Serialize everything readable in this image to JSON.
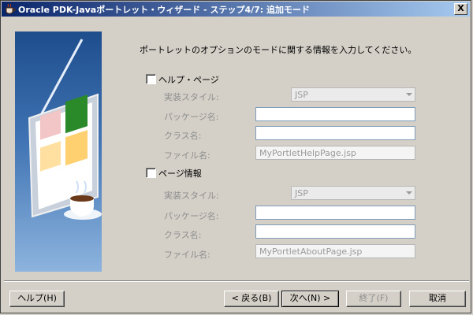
{
  "window": {
    "title": "Oracle PDK-Javaポートレット・ウィザード - ステップ4/7: 追加モード",
    "close_label": "X"
  },
  "intro_text": "ポートレットのオプションのモードに関する情報を入力してください。",
  "help_page": {
    "checkbox_label": "ヘルプ・ページ",
    "checked": false,
    "impl_style_label": "実装スタイル:",
    "impl_style_value": "JSP",
    "package_label": "パッケージ名:",
    "package_value": "",
    "class_label": "クラス名:",
    "class_value": "",
    "file_label": "ファイル名:",
    "file_value": "MyPortletHelpPage.jsp"
  },
  "about_page": {
    "checkbox_label": "ページ情報",
    "checked": false,
    "impl_style_label": "実装スタイル:",
    "impl_style_value": "JSP",
    "package_label": "パッケージ名:",
    "package_value": "",
    "class_label": "クラス名:",
    "class_value": "",
    "file_label": "ファイル名:",
    "file_value": "MyPortletAboutPage.jsp"
  },
  "buttons": {
    "help": "ヘルプ(H)",
    "back": "< 戻る(B)",
    "next": "次へ(N) >",
    "finish": "終了(F)",
    "cancel": "取消"
  },
  "colors": {
    "title_start": "#0a246a",
    "title_end": "#a6caf0",
    "art_top": "#1e4d8c",
    "art_bottom": "#8db4de"
  }
}
